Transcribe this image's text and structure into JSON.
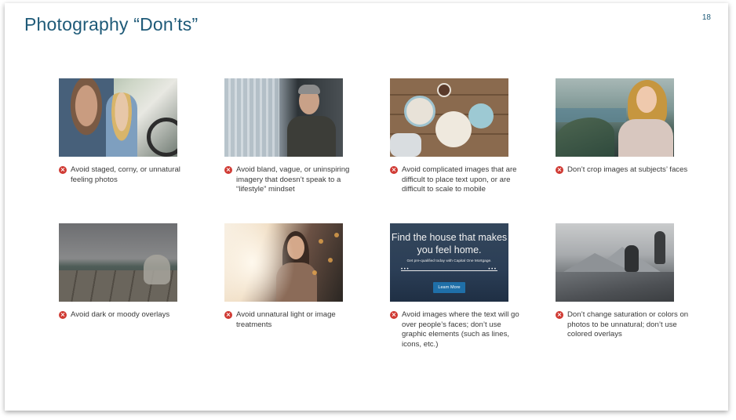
{
  "slide": {
    "title": "Photography “Don’ts”",
    "page_number": "18"
  },
  "icons": {
    "caption_marker": "x-circle-icon",
    "marker_color": "#d03a33"
  },
  "colors": {
    "title": "#1e5a78",
    "text": "#3a3a3a"
  },
  "items": [
    {
      "photo": "couple-in-car-photo",
      "caption": "Avoid staged, corny, or unnatural feeling photos"
    },
    {
      "photo": "businessman-window-photo",
      "caption": "Avoid bland, vague, or uninspiring imagery that doesn’t speak to a “lifestyle” mindset"
    },
    {
      "photo": "breakfast-table-photo",
      "caption": "Avoid complicated images that are difficult to place text upon, or are difficult to scale to mobile"
    },
    {
      "photo": "cropped-face-coast-photo",
      "caption": "Don’t crop images at subjects’ faces"
    },
    {
      "photo": "dark-overlay-dock-photo",
      "caption": "Avoid dark or moody overlays"
    },
    {
      "photo": "light-leak-woman-photo",
      "caption": "Avoid unnatural light or image treatments"
    },
    {
      "photo": "text-over-face-ad-photo",
      "caption": "Avoid images where the text will go over people’s faces; don’t use graphic elements (such as lines, icons, etc.)"
    },
    {
      "photo": "desaturated-mountain-photo",
      "caption": "Don’t change saturation or colors on photos to be unnatural; don’t use colored overlays"
    }
  ],
  "ad_example": {
    "headline": "Find the house that makes you feel home.",
    "subtext": "Get pre-qualified today with Capital One Mortgage.",
    "button_label": "Learn More"
  }
}
